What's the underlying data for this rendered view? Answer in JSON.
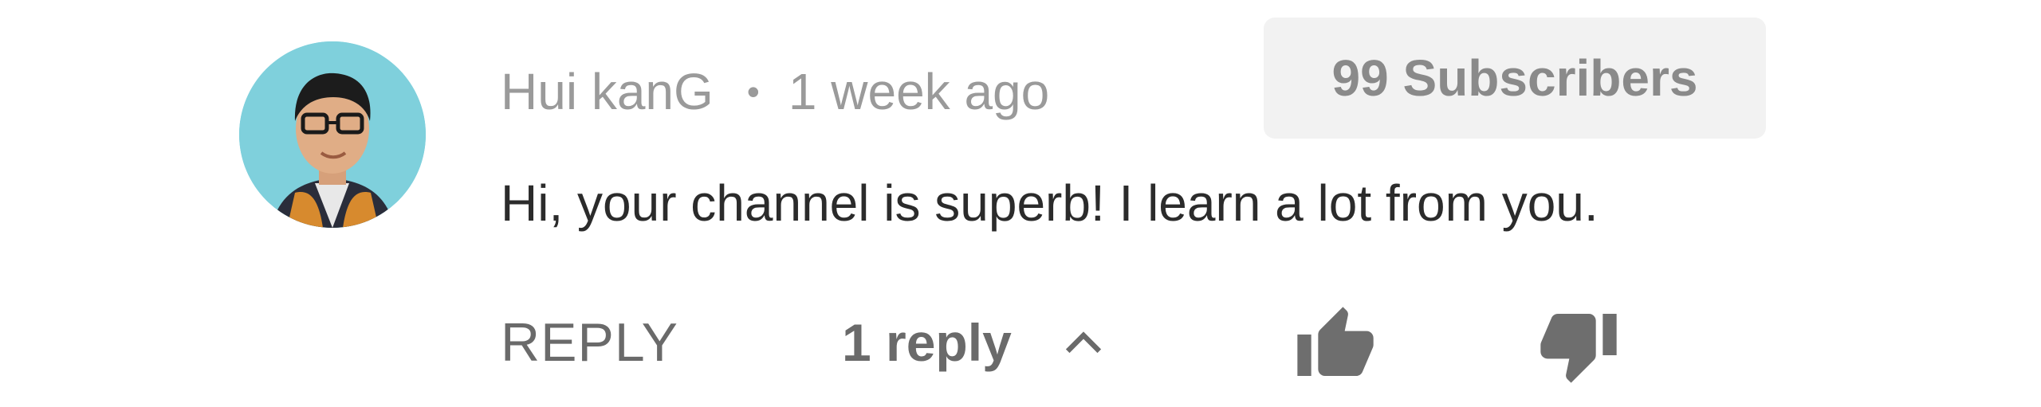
{
  "comment": {
    "author": "Hui kanG",
    "separator": "•",
    "time": "1 week ago",
    "subscriber_badge": "99 Subscribers",
    "text": "Hi, your channel is superb! I learn a lot from you."
  },
  "actions": {
    "reply_label": "REPLY",
    "replies_label": "1 reply"
  },
  "icons": {
    "avatar": "profile-photo",
    "toggle": "chevron-up-icon",
    "like": "thumbs-up-icon",
    "dislike": "thumbs-down-icon"
  },
  "colors": {
    "meta_text": "#9a9a9a",
    "body_text": "#2b2b2b",
    "action_text": "#6a6a6a",
    "badge_bg": "#f2f2f2"
  }
}
